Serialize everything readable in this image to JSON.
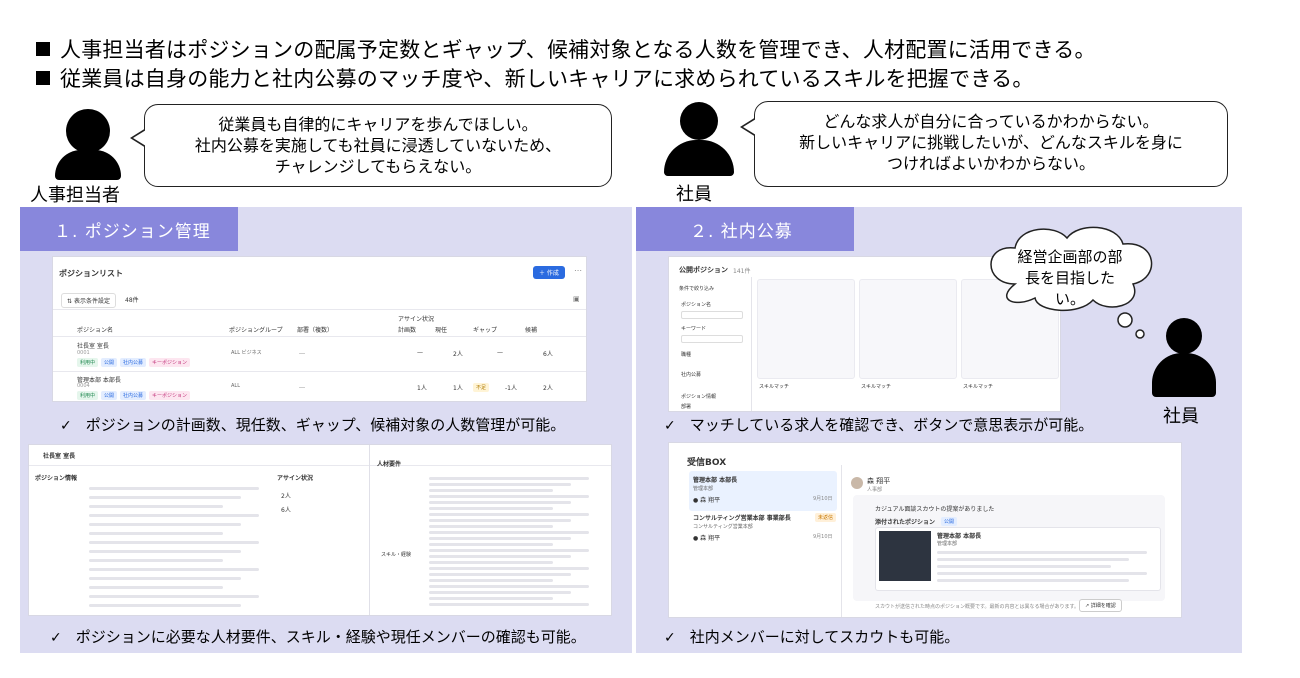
{
  "headlines": [
    "人事担当者はポジションの配属予定数とギャップ、候補対象となる人数を管理でき、人材配置に活用できる。",
    "従業員は自身の能力と社内公募のマッチ度や、新しいキャリアに求められているスキルを把握できる。"
  ],
  "left_speaker": {
    "role": "人事担当者",
    "speech": [
      "従業員も自律的にキャリアを歩んでほしい。",
      "社内公募を実施しても社員に浸透していないため、",
      "チャレンジしてもらえない。"
    ]
  },
  "right_speaker": {
    "role": "社員",
    "speech": [
      "どんな求人が自分に合っているかわからない。",
      "新しいキャリアに挑戦したいが、どんなスキルを身に",
      "つければよいかわからない。"
    ]
  },
  "thought": {
    "text": [
      "経営企画部の部",
      "長を目指したい。"
    ],
    "role": "社員"
  },
  "panel1": {
    "tab": "１. ポジション管理",
    "check1": "ポジションの計画数、現任数、ギャップ、候補対象の人数管理が可能。",
    "check2": "ポジションに必要な人材要件、スキル・経験や現任メンバーの確認も可能。",
    "shot": {
      "title": "ポジションリスト",
      "create": "＋ 作成",
      "filter": "表示条件設定",
      "count": "48件",
      "headers": [
        "ポジション名",
        "ポジショングループ",
        "部署（複数）",
        "アサイン状況",
        "計画数",
        "現任",
        "ギャップ",
        "候補"
      ],
      "rows": [
        {
          "name": "社長室 室長",
          "code": "0001",
          "tags": [
            "利用中",
            "公開",
            "社内公募",
            "キーポジション"
          ],
          "group": "ALL ビジネス",
          "dept": "…",
          "plan": "—",
          "current": "2人",
          "gap": "—",
          "cand": "6人"
        },
        {
          "name": "管理本部 本部長",
          "code": "0004",
          "tags": [
            "利用中",
            "公開",
            "社内公募",
            "キーポジション"
          ],
          "group": "ALL",
          "dept": "…",
          "plan": "1人",
          "current": "1人",
          "gap": "-1人",
          "cand": "2人"
        }
      ],
      "gap_badge": "不足"
    },
    "shot2": {
      "pos_title": "社長室 室長",
      "section": "ポジション情報",
      "assign": "アサイン状況",
      "requirements": "人材要件",
      "skills": "スキル・経験",
      "current_num": "2人",
      "plan_num": "6人"
    }
  },
  "panel2": {
    "tab": "２. 社内公募",
    "check1": "マッチしている求人を確認でき、ボタンで意思表示が可能。",
    "check2": "社内メンバーに対してスカウトも可能。",
    "shot": {
      "title": "公開ポジション",
      "count": "141件",
      "filter": "条件で絞り込み",
      "labels": [
        "ポジション名",
        "キーワード",
        "職種",
        "社内公募",
        "ポジション情報",
        "部署"
      ],
      "match": "スキルマッチ"
    },
    "inbox": {
      "title": "受信BOX",
      "items": [
        {
          "title": "管理本部 本部長",
          "sub": "管理本部",
          "sender": "森 翔平",
          "date": "9月10日"
        },
        {
          "title": "コンサルティング営業本部 事業部長",
          "sub": "コンサルティング営業本部",
          "sender": "森 翔平",
          "date": "9月10日",
          "badge": "未返信"
        }
      ],
      "detail_sender": "森 翔平",
      "detail_dept": "人事部",
      "message": "カジュアル面談スカウトの提案がありました",
      "attached": "添付されたポジション",
      "attached_tag": "公開",
      "pos": "管理本部 本部長",
      "pos_dept": "管理本部",
      "footer": "スカウトが送信された時点のポジション概要です。最新の内容とは異なる場合があります。",
      "detail_btn": "詳細を確認"
    }
  }
}
